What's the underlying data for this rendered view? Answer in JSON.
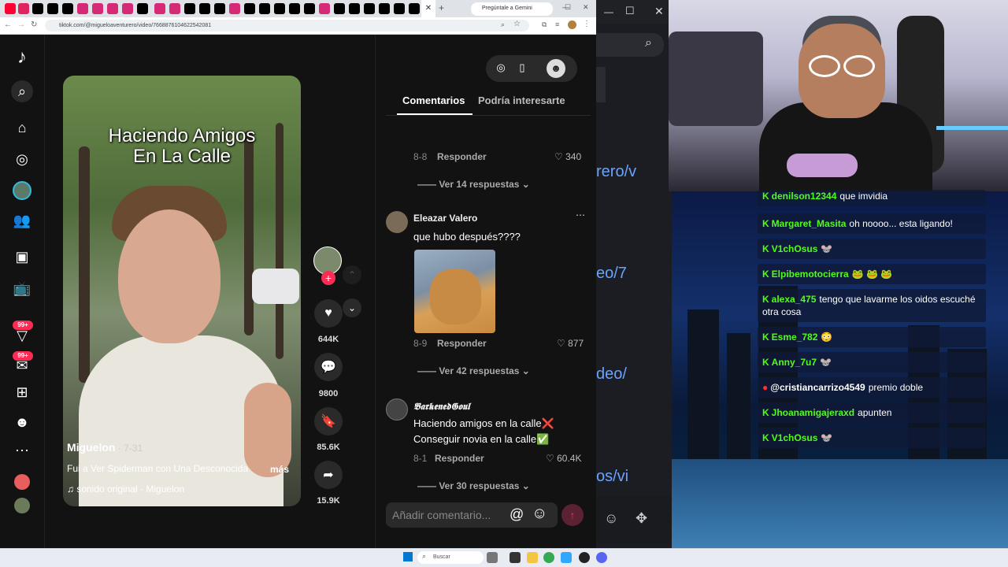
{
  "browser": {
    "gemini_tab": "Pregúntale a Gemini",
    "url": "tiktok.com/@migueloaventurero/video/7668876104622542081",
    "window_controls": [
      "—",
      "☐",
      "✕"
    ]
  },
  "tiktok": {
    "video": {
      "overlay_title_line1": "Haciendo Amigos",
      "overlay_title_line2": "En La Calle",
      "author": "Miguelon",
      "date": " · 7-31",
      "description": "Fui a Ver Spiderman con Una Desconocida",
      "more": "más",
      "sound": "♫  sonido original - Miguelon"
    },
    "actions": {
      "likes": "644K",
      "comments": "9800",
      "saves": "85.6K",
      "shares": "15.9K"
    },
    "nav_badges": [
      "99+",
      "99+"
    ],
    "tabs": {
      "comments": "Comentarios",
      "interest": "Podría interesarte"
    },
    "comments": [
      {
        "date": "8-8",
        "reply": "Responder",
        "likes": "340",
        "view_more": "Ver 14 respuestas"
      },
      {
        "name": "Eleazar Valero",
        "text": "que hubo después????",
        "date": "8-9",
        "reply": "Responder",
        "likes": "877",
        "view_more": "Ver 42 respuestas"
      },
      {
        "name": "𝕭𝖆𝖗𝖐𝖊𝖓𝖊𝖉𝕲𝖔𝖚𝖑",
        "name_display": "DarkenedSoul",
        "text_line1": "Haciendo amigos en la calle❌",
        "text_line2": "Conseguir novia en la calle✅",
        "date": "8-1",
        "reply": "Responder",
        "likes": "60.4K",
        "view_more": "Ver 30 respuestas"
      }
    ],
    "composer_placeholder": "Añadir comentario...",
    "composer_icons": [
      "@",
      "☺"
    ],
    "send": "↑"
  },
  "bg_window_urls": [
    "rero/v",
    "eo/7",
    "deo/",
    "os/vi"
  ],
  "chat": [
    {
      "user": "denilson12344",
      "text": "que imvidia",
      "platform": "kick"
    },
    {
      "user": "Margaret_Masita",
      "text": "oh noooo... esta ligando!",
      "platform": "kick"
    },
    {
      "user": "V1chOsus",
      "text": "🐭",
      "platform": "kick"
    },
    {
      "user": "Elpibemotocierra",
      "text": "🐸 🐸 🐸",
      "platform": "kick"
    },
    {
      "user": "alexa_475",
      "text": "tengo que lavarme los oidos escuché otra cosa",
      "platform": "kick"
    },
    {
      "user": "Esme_782",
      "text": "😳",
      "platform": "kick"
    },
    {
      "user": "Anny_7u7",
      "text": "🐭",
      "platform": "kick"
    },
    {
      "user": "@cristiancarrizo4549",
      "text": "premio doble",
      "platform": "youtube"
    },
    {
      "user": "Jhoanamigajeraxd",
      "text": "apunten",
      "platform": "kick"
    },
    {
      "user": "V1chOsus",
      "text": "🐭",
      "platform": "kick"
    }
  ],
  "taskbar": {
    "search": "Buscar"
  },
  "colors": {
    "tiktok_pink": "#fe2c55",
    "kick_green": "#53fc18",
    "panel_bg": "#121212"
  }
}
